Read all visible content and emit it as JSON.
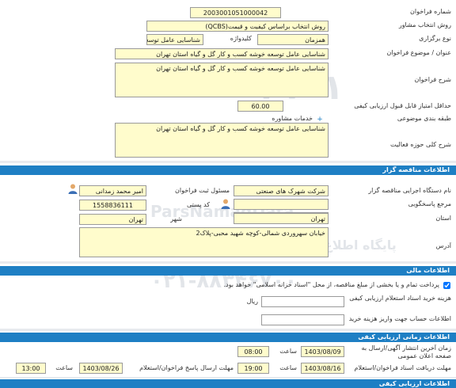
{
  "tender": {
    "number_label": "شماره فراخوان",
    "number": "2003001051000042",
    "selection_method_label": "روش انتخاب مشاور",
    "selection_method": "روش انتخاب براساس کیفیت و قیمت(QCBS)",
    "holding_type_label": "نوع برگزاری",
    "holding_type": "همزمان",
    "keyword_label": "کلیدواژه",
    "keyword": "شناسایی عامل توسعه خوشه",
    "title_label": "عنوان / موضوع فراخوان",
    "title": "شناسایی عامل توسعه خوشه کسب و کار گل و گیاه استان تهران",
    "description_label": "شرح فراخوان",
    "description": "شناسایی عامل توسعه خوشه کسب و کار گل و گیاه استان تهران",
    "min_score_label": "حداقل امتیاز قابل قبول ارزیابی کیفی",
    "min_score": "60.00",
    "category_label": "طبقه بندی موضوعی",
    "category": "خدمات مشاوره",
    "scope_label": "شرح کلی حوزه فعالیت",
    "scope": "شناسایی عامل توسعه خوشه کسب و کار گل و گیاه استان تهران"
  },
  "organizer": {
    "section_title": "اطلاعات مناقصه گزار",
    "org_name_label": "نام دستگاه اجرایی مناقصه گزار",
    "org_name": "شرکت شهرک های صنعتی",
    "officer_label": "مسئول ثبت فراخوان",
    "officer": "امیر محمد زمدانی",
    "response_ref_label": "مرجع پاسخگویی",
    "response_ref": "",
    "postal_code_label": "کد پستی",
    "postal_code": "1558836111",
    "province_label": "استان",
    "province": "تهران",
    "city_label": "شهر",
    "city": "تهران",
    "address_label": "آدرس",
    "address": "خیابان سهروردی شمالی-کوچه شهید محبی-پلاک2"
  },
  "financial": {
    "section_title": "اطلاعات مالی",
    "payment_text": "پرداخت تمام و یا بخشی از مبلغ مناقصه، از محل \"اسناد خزانه اسلامی\" خواهد بود.",
    "doc_fee_label": "هزینه خرید اسناد استعلام ارزیابی کیفی",
    "doc_fee_unit": "ریال",
    "doc_fee": "",
    "account_label": "اطلاعات حساب جهت واریز هزینه خرید",
    "account": ""
  },
  "timing": {
    "section_title": "اطلاعات زمانی ارزیابی کیفی",
    "publish_deadline_label": "زمان آخرین انتشار آگهی/ارسال به صفحه اعلان عمومی",
    "publish_date": "1403/08/09",
    "publish_time_label": "ساعت",
    "publish_time": "08:00",
    "receive_deadline_label": "مهلت دریافت اسناد فراخوان/استعلام",
    "receive_date": "1403/08/16",
    "receive_time_label": "ساعت",
    "receive_time": "19:00",
    "send_deadline_label": "مهلت ارسال پاسخ فراخوان/استعلام",
    "send_date": "1403/08/26",
    "send_time_label": "ساعت",
    "send_time": "13:00"
  },
  "next_section_title": "اطلاعات ارزیابی کیفی",
  "watermark": {
    "line1": "ParsNamadData",
    "line2": "پایگاه اطلاع رسانی مناقصه و مزایده",
    "phone": "۰۲۱-۸۸۳۴۶۷۰۰"
  },
  "colors": {
    "accent": "#1e7fc4",
    "field_bg": "#fffccc"
  }
}
